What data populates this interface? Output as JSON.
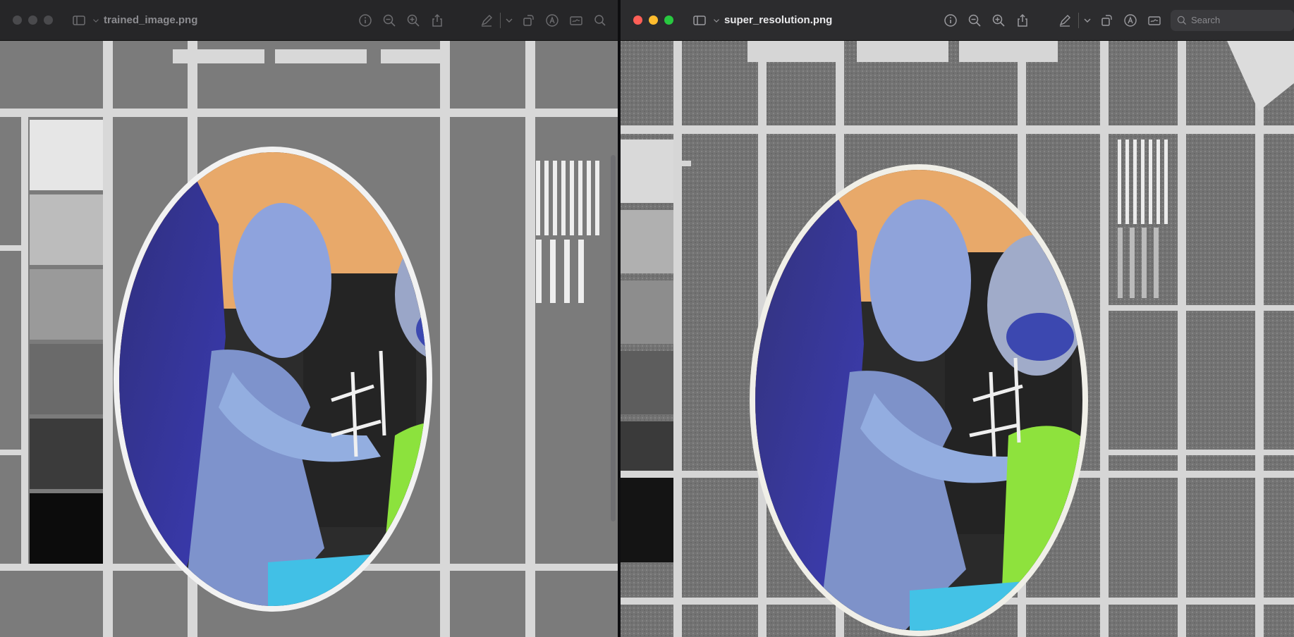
{
  "left_window": {
    "title": "trained_image.png"
  },
  "right_window": {
    "title": "super_resolution.png",
    "search": {
      "placeholder": "Search"
    }
  },
  "colors": {
    "close": "#ff5f57",
    "minimize": "#febc2e",
    "zoom": "#28c840",
    "inactive_light": "#4a4a4d",
    "photo_background": "#e8a96a",
    "chart_gray": "#7d7d7d"
  }
}
